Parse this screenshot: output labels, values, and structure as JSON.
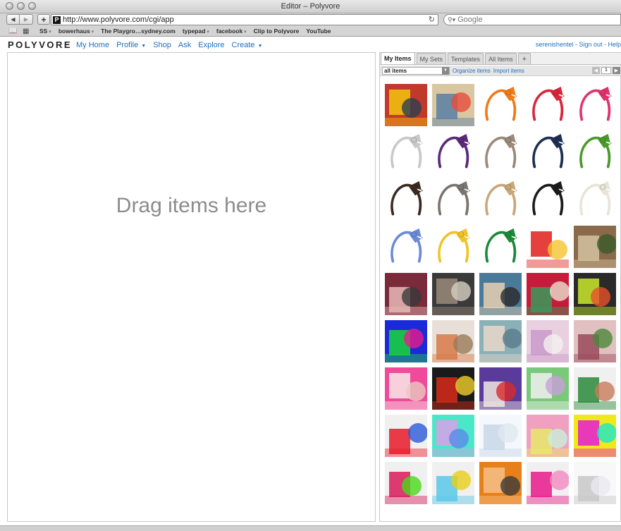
{
  "browser": {
    "window_title": "Editor – Polyvore",
    "url": "http://www.polyvore.com/cgi/app",
    "favicon_letter": "P",
    "search_placeholder": "Google",
    "bookmarks": [
      {
        "label": "SS",
        "menu": true
      },
      {
        "label": "bowerhaus",
        "menu": true
      },
      {
        "label": "The Playgro…sydney.com",
        "menu": false
      },
      {
        "label": "typepad",
        "menu": true
      },
      {
        "label": "facebook",
        "menu": true
      },
      {
        "label": "Clip to Polyvore",
        "menu": false
      },
      {
        "label": "YouTube",
        "menu": false
      }
    ]
  },
  "header": {
    "logo": "POLYVORE",
    "nav": [
      {
        "label": "My Home",
        "menu": false
      },
      {
        "label": "Profile",
        "menu": true
      },
      {
        "label": "Shop",
        "menu": false
      },
      {
        "label": "Ask",
        "menu": false
      },
      {
        "label": "Explore",
        "menu": false
      },
      {
        "label": "Create",
        "menu": true
      }
    ],
    "user_links": "serenishentel - Sign out - Help"
  },
  "canvas": {
    "placeholder": "Drag items here"
  },
  "panel": {
    "tabs": [
      {
        "label": "My Items",
        "active": true
      },
      {
        "label": "My Sets",
        "active": false
      },
      {
        "label": "Templates",
        "active": false
      },
      {
        "label": "All Items",
        "active": false
      },
      {
        "label": "+",
        "active": false
      }
    ],
    "filter_value": "all items",
    "organize_label": "Organize items",
    "import_label": "Import items",
    "page_number": "1",
    "items": [
      {
        "kind": "photo",
        "colors": [
          "#c0392b",
          "#f1c40f",
          "#2c3e50"
        ]
      },
      {
        "kind": "photo",
        "colors": [
          "#d8c7a0",
          "#5b7fa6",
          "#e74c3c"
        ]
      },
      {
        "kind": "headband",
        "color": "#f07a1a"
      },
      {
        "kind": "headband",
        "color": "#d8263a"
      },
      {
        "kind": "headband",
        "color": "#e0336c"
      },
      {
        "kind": "headband",
        "color": "#c8c8cc"
      },
      {
        "kind": "headband",
        "color": "#5a2a78"
      },
      {
        "kind": "headband",
        "color": "#9a8a78"
      },
      {
        "kind": "headband",
        "color": "#1d2e52"
      },
      {
        "kind": "headband",
        "color": "#4a9a2a"
      },
      {
        "kind": "headband",
        "color": "#3a2a22"
      },
      {
        "kind": "headband",
        "color": "#7a7472"
      },
      {
        "kind": "headband",
        "color": "#c8a878"
      },
      {
        "kind": "headband",
        "color": "#1a1a1a"
      },
      {
        "kind": "headband",
        "color": "#e8e4d8"
      },
      {
        "kind": "headband",
        "color": "#6a8ad8"
      },
      {
        "kind": "headband",
        "color": "#f0c428"
      },
      {
        "kind": "headband",
        "color": "#1a8a3a"
      },
      {
        "kind": "photo",
        "colors": [
          "#ffffff",
          "#e0201a",
          "#f4c430"
        ]
      },
      {
        "kind": "photo",
        "colors": [
          "#8a6a4a",
          "#d4c2a0",
          "#3a5a2a"
        ]
      },
      {
        "kind": "photo",
        "colors": [
          "#7a2a3a",
          "#e8b8b8",
          "#3a3a3a"
        ]
      },
      {
        "kind": "photo",
        "colors": [
          "#3a3a3a",
          "#9a8a7a",
          "#d8d0c0"
        ]
      },
      {
        "kind": "photo",
        "colors": [
          "#4a7a9a",
          "#e8d0b0",
          "#2a2a2a"
        ]
      },
      {
        "kind": "photo",
        "colors": [
          "#c81a3a",
          "#3a9a5a",
          "#e8e0d0"
        ]
      },
      {
        "kind": "photo",
        "colors": [
          "#2a2a2a",
          "#c8e82a",
          "#e8502a"
        ]
      },
      {
        "kind": "photo",
        "colors": [
          "#1a2ad8",
          "#1ad83a",
          "#e81a8a"
        ]
      },
      {
        "kind": "photo",
        "colors": [
          "#e8e0d8",
          "#d87a4a",
          "#9a7a5a"
        ]
      },
      {
        "kind": "photo",
        "colors": [
          "#8ab0b8",
          "#e8d8c8",
          "#5a7a8a"
        ]
      },
      {
        "kind": "photo",
        "colors": [
          "#e8d0e0",
          "#c89ac8",
          "#f4f0f0"
        ]
      },
      {
        "kind": "photo",
        "colors": [
          "#e0c0c0",
          "#9a4a5a",
          "#4a8a3a"
        ]
      },
      {
        "kind": "photo",
        "colors": [
          "#f04a9a",
          "#f8e8e8",
          "#e8c8c0"
        ]
      },
      {
        "kind": "photo",
        "colors": [
          "#1a1a1a",
          "#d82a1a",
          "#f0d02a"
        ]
      },
      {
        "kind": "photo",
        "colors": [
          "#5a3a9a",
          "#f0e8e0",
          "#d82a2a"
        ]
      },
      {
        "kind": "photo",
        "colors": [
          "#7ac87a",
          "#f0f0f0",
          "#c8a0d8"
        ]
      },
      {
        "kind": "photo",
        "colors": [
          "#f0f0f0",
          "#2a8a3a",
          "#c87a5a"
        ]
      },
      {
        "kind": "photo",
        "colors": [
          "#f0f0f0",
          "#e81a2a",
          "#2a5ad8"
        ]
      },
      {
        "kind": "photo",
        "colors": [
          "#4ae8c8",
          "#d8a0e8",
          "#5a8ae8"
        ]
      },
      {
        "kind": "photo",
        "colors": [
          "#f4f8fc",
          "#c8d8e8",
          "#e0e8f0"
        ]
      },
      {
        "kind": "photo",
        "colors": [
          "#f0a0c0",
          "#e8e86a",
          "#c8f0d8"
        ]
      },
      {
        "kind": "photo",
        "colors": [
          "#f0e81a",
          "#e81ad8",
          "#1ae8c8"
        ]
      },
      {
        "kind": "photo",
        "colors": [
          "#f0f0f0",
          "#d81a5a",
          "#4ad81a"
        ]
      },
      {
        "kind": "photo",
        "colors": [
          "#f0f0f0",
          "#5ac8e8",
          "#e8d01a"
        ]
      },
      {
        "kind": "photo",
        "colors": [
          "#e8801a",
          "#f4c088",
          "#3a3a3a"
        ]
      },
      {
        "kind": "photo",
        "colors": [
          "#f0f0f0",
          "#e81a8a",
          "#f48ac0"
        ]
      },
      {
        "kind": "photo",
        "colors": [
          "#f8f8f8",
          "#c8c8c8",
          "#e8e8f0"
        ]
      }
    ]
  }
}
